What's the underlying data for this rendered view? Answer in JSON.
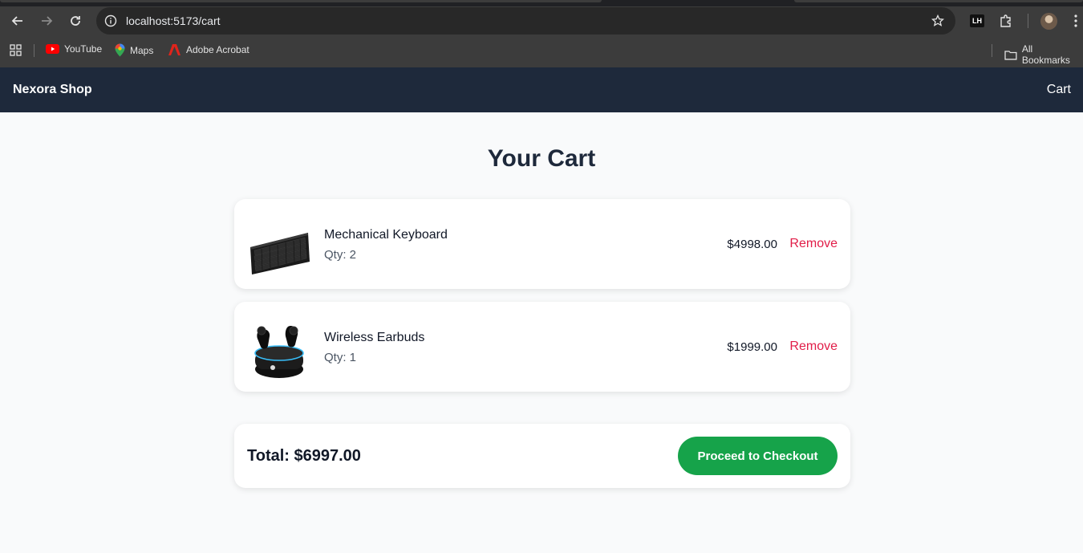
{
  "browser": {
    "url": "localhost:5173/cart",
    "bookmarks": [
      {
        "label": "YouTube",
        "icon": "youtube-icon"
      },
      {
        "label": "Maps",
        "icon": "maps-icon"
      },
      {
        "label": "Adobe Acrobat",
        "icon": "acrobat-icon"
      }
    ],
    "all_bookmarks_label": "All Bookmarks",
    "extension_badge": "LH"
  },
  "navbar": {
    "brand": "Nexora Shop",
    "cart_link": "Cart",
    "bg_color": "#1e293b"
  },
  "main": {
    "title": "Your Cart",
    "items": [
      {
        "name": "Mechanical Keyboard",
        "qty": "Qty: 2",
        "price": "$4998.00",
        "remove_label": "Remove",
        "image": "keyboard-image"
      },
      {
        "name": "Wireless Earbuds",
        "qty": "Qty: 1",
        "price": "$1999.00",
        "remove_label": "Remove",
        "image": "earbuds-image"
      }
    ],
    "total": "Total: $6997.00",
    "checkout_label": "Proceed to Checkout",
    "accent_color": "#16a34a",
    "remove_color": "#e11d48"
  }
}
